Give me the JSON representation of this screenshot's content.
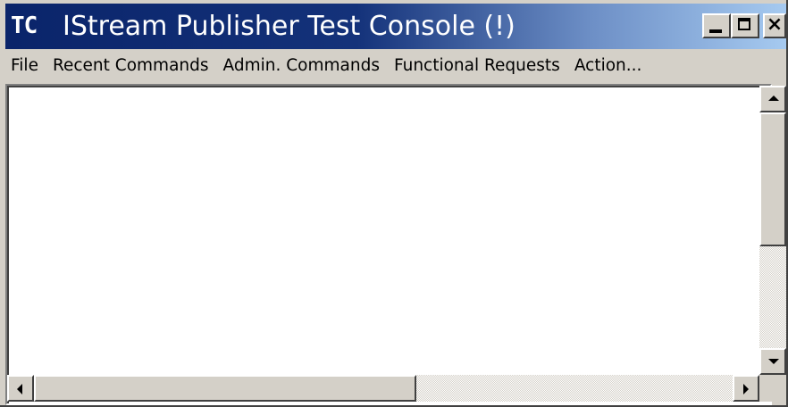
{
  "window": {
    "icon_text": "TC",
    "title": "IStream Publisher Test Console (!)",
    "controls": {
      "minimize": "minimize",
      "maximize": "maximize",
      "close": "×"
    }
  },
  "menu": {
    "items": [
      {
        "label": "File"
      },
      {
        "label": "Recent Commands"
      },
      {
        "label": "Admin. Commands"
      },
      {
        "label": "Functional Requests"
      },
      {
        "label": "Action..."
      }
    ]
  },
  "console": {
    "value": ""
  },
  "colors": {
    "titlebar_start": "#0a246a",
    "titlebar_end": "#a6caf0",
    "face": "#d4d0c8",
    "content_bg": "#ffffff"
  },
  "icons": {
    "scroll_up": "arrow-up-icon",
    "scroll_down": "arrow-down-icon",
    "scroll_left": "arrow-left-icon",
    "scroll_right": "arrow-right-icon"
  }
}
